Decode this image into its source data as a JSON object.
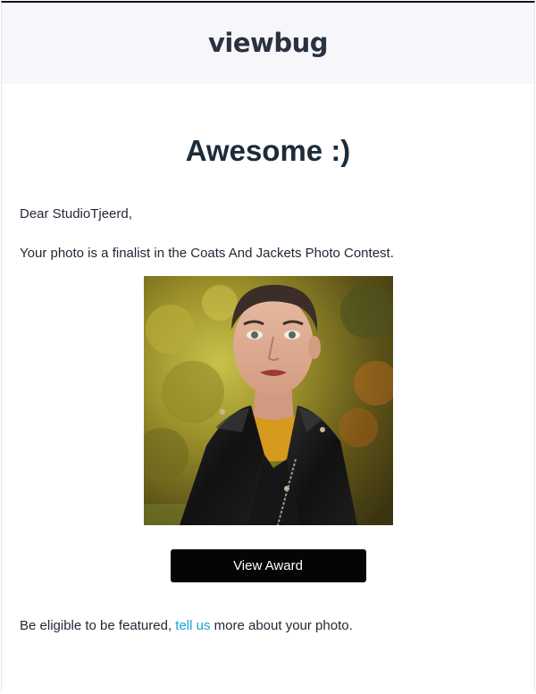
{
  "header": {
    "logo_text": "viewbug"
  },
  "content": {
    "headline": "Awesome :)",
    "greeting": "Dear StudioTjeerd,",
    "message": "Your photo is a finalist in the Coats And Jackets Photo Contest.",
    "photo": {
      "subject": "portrait-photo",
      "description_icon": "portrait-photo-icon"
    },
    "button_label": "View Award",
    "footer": {
      "before_link": "Be eligible to be featured, ",
      "link_text": "tell us",
      "after_link": " more about your photo."
    }
  },
  "colors": {
    "header_bg": "#f7f7fb",
    "button_bg": "#050505",
    "link": "#1aa3d6",
    "headline": "#1b2c3b"
  }
}
